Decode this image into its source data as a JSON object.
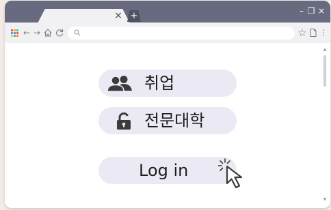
{
  "tabs": {
    "close_glyph": "×",
    "new_tab_glyph": "+"
  },
  "window_controls": {
    "minimize": "–",
    "restore": "❐",
    "close": "×"
  },
  "toolbar": {
    "back": "←",
    "forward": "→",
    "home": "⌂",
    "reload": "↻",
    "star": "☆",
    "page": "🗋",
    "menu": "⋮",
    "url_value": ""
  },
  "menu": {
    "items": [
      {
        "label": "취업",
        "icon": "users-icon"
      },
      {
        "label": "전문대학",
        "icon": "lock-icon"
      },
      {
        "label": "Log in",
        "icon": "cursor-click-icon"
      }
    ]
  },
  "colors": {
    "titlebar": "#686b7f",
    "toolbar": "#f1f1f4",
    "button_bg": "#ebe9f3",
    "icon_dark": "#3b3b3b",
    "apps": [
      "#e84c3d",
      "#f39c12",
      "#2ecc71",
      "#3498db",
      "#9b59b6",
      "#e84c3d",
      "#f1c40f",
      "#1abc9c",
      "#e67e22"
    ]
  }
}
